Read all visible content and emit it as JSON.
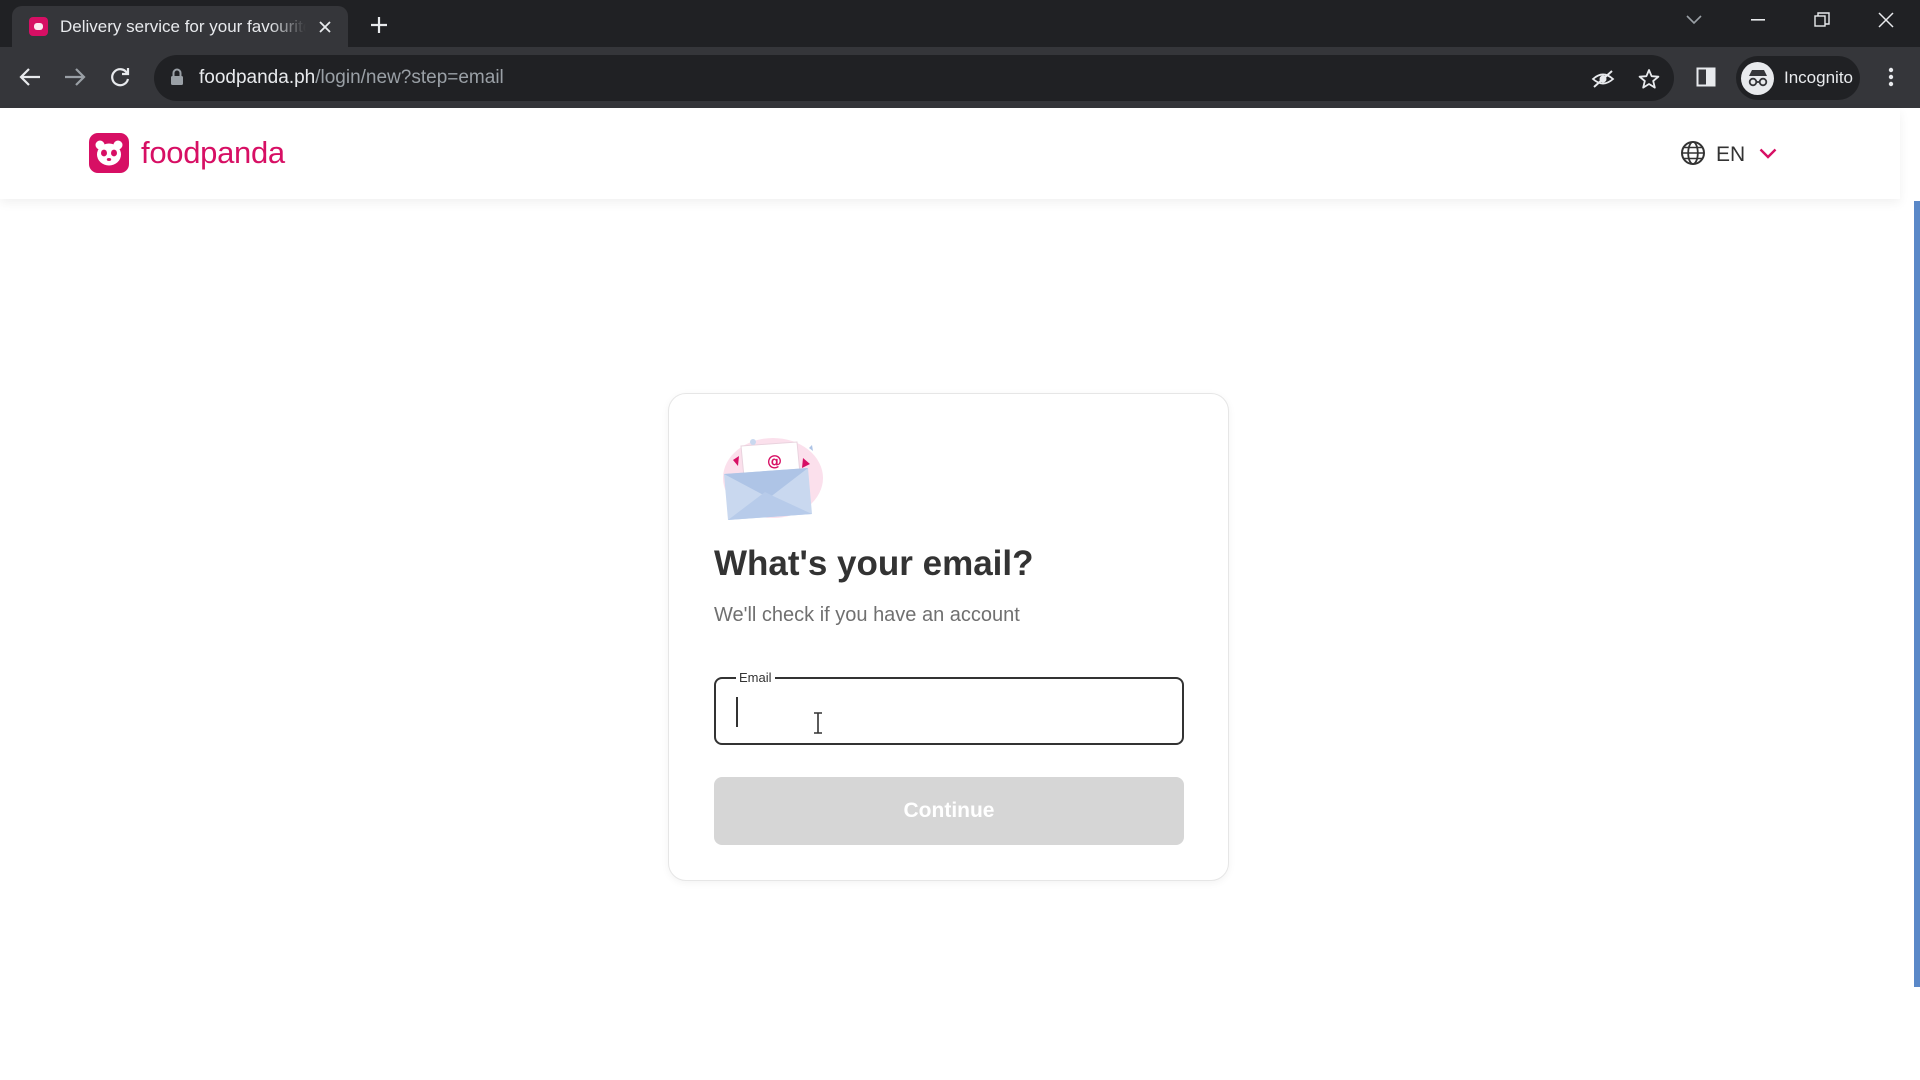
{
  "browser": {
    "tab_title": "Delivery service for your favourite food",
    "url_host": "foodpanda.ph",
    "url_path": "/login/new?step=email",
    "profile_label": "Incognito"
  },
  "header": {
    "logo_text": "foodpanda",
    "language": "EN"
  },
  "login": {
    "heading": "What's your email?",
    "subtext": "We'll check if you have an account",
    "email_label": "Email",
    "email_value": "",
    "continue_label": "Continue"
  },
  "colors": {
    "brand": "#d70f64",
    "button_disabled": "#d6d6d6",
    "text_dark": "#333333",
    "text_muted": "#707070"
  },
  "icons": [
    "foodpanda-logo-icon",
    "globe-icon",
    "chevron-down-icon",
    "envelope-icon",
    "back-icon",
    "forward-icon",
    "reload-icon",
    "lock-icon",
    "eye-off-icon",
    "star-icon",
    "side-panel-icon",
    "incognito-icon",
    "menu-icon"
  ]
}
